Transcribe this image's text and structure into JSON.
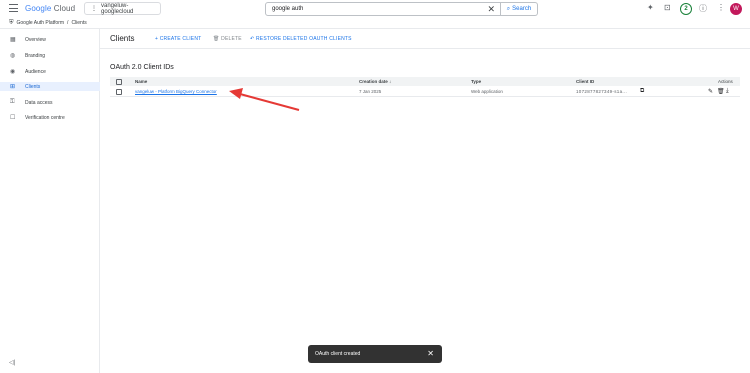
{
  "header": {
    "logo_google": "Google",
    "logo_cloud": "Cloud",
    "project": "vangeluw-googlecloud",
    "search_value": "google auth",
    "search_button": "Search",
    "notification_count": "2",
    "avatar_letter": "W"
  },
  "breadcrumb": {
    "root": "Google Auth Platform",
    "separator": "/",
    "current": "Clients"
  },
  "sidebar": {
    "items": [
      {
        "label": "Overview",
        "icon": "overview-icon"
      },
      {
        "label": "Branding",
        "icon": "branding-icon"
      },
      {
        "label": "Audience",
        "icon": "audience-icon"
      },
      {
        "label": "Clients",
        "icon": "clients-icon"
      },
      {
        "label": "Data access",
        "icon": "data-access-icon"
      },
      {
        "label": "Verification centre",
        "icon": "verification-icon"
      }
    ]
  },
  "toolbar": {
    "title": "Clients",
    "create_label": "CREATE CLIENT",
    "delete_label": "DELETE",
    "restore_label": "RESTORE DELETED OAUTH CLIENTS"
  },
  "section": {
    "title": "OAuth 2.0 Client IDs"
  },
  "table": {
    "columns": [
      "Name",
      "Creation date",
      "Type",
      "Client ID",
      "Actions"
    ],
    "rows": [
      {
        "name": "vangeluw - Platform BigQuery Connector",
        "date": "7 Jan 2025",
        "type": "Web application",
        "client_id": "1072877827349-s1a..."
      }
    ]
  },
  "toast": {
    "message": "OAuth client created"
  },
  "colors": {
    "accent": "#1a73e8",
    "active_bg": "#e8f0fe",
    "annotation_arrow": "#e53935",
    "toast_bg": "#323232"
  }
}
